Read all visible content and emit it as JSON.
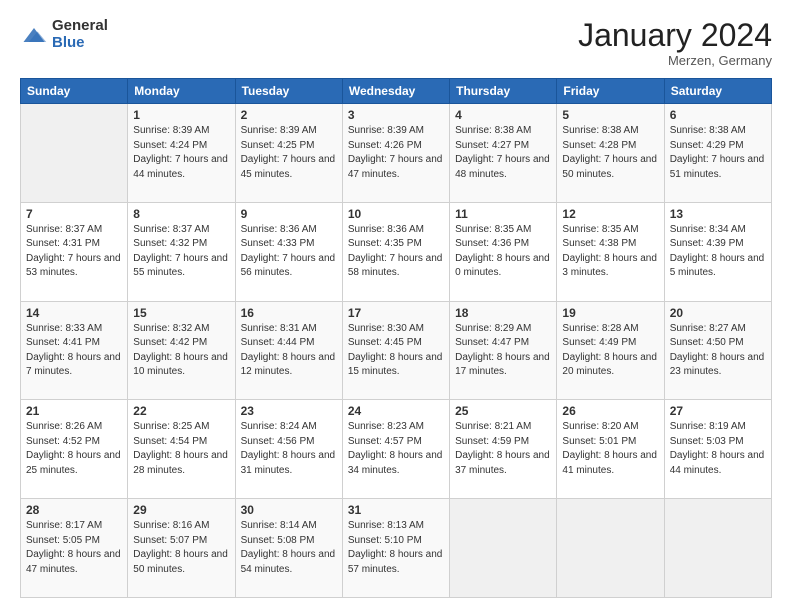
{
  "logo": {
    "general": "General",
    "blue": "Blue"
  },
  "header": {
    "month": "January 2024",
    "location": "Merzen, Germany"
  },
  "days_of_week": [
    "Sunday",
    "Monday",
    "Tuesday",
    "Wednesday",
    "Thursday",
    "Friday",
    "Saturday"
  ],
  "weeks": [
    [
      {
        "day": "",
        "sunrise": "",
        "sunset": "",
        "daylight": ""
      },
      {
        "day": "1",
        "sunrise": "Sunrise: 8:39 AM",
        "sunset": "Sunset: 4:24 PM",
        "daylight": "Daylight: 7 hours and 44 minutes."
      },
      {
        "day": "2",
        "sunrise": "Sunrise: 8:39 AM",
        "sunset": "Sunset: 4:25 PM",
        "daylight": "Daylight: 7 hours and 45 minutes."
      },
      {
        "day": "3",
        "sunrise": "Sunrise: 8:39 AM",
        "sunset": "Sunset: 4:26 PM",
        "daylight": "Daylight: 7 hours and 47 minutes."
      },
      {
        "day": "4",
        "sunrise": "Sunrise: 8:38 AM",
        "sunset": "Sunset: 4:27 PM",
        "daylight": "Daylight: 7 hours and 48 minutes."
      },
      {
        "day": "5",
        "sunrise": "Sunrise: 8:38 AM",
        "sunset": "Sunset: 4:28 PM",
        "daylight": "Daylight: 7 hours and 50 minutes."
      },
      {
        "day": "6",
        "sunrise": "Sunrise: 8:38 AM",
        "sunset": "Sunset: 4:29 PM",
        "daylight": "Daylight: 7 hours and 51 minutes."
      }
    ],
    [
      {
        "day": "7",
        "sunrise": "Sunrise: 8:37 AM",
        "sunset": "Sunset: 4:31 PM",
        "daylight": "Daylight: 7 hours and 53 minutes."
      },
      {
        "day": "8",
        "sunrise": "Sunrise: 8:37 AM",
        "sunset": "Sunset: 4:32 PM",
        "daylight": "Daylight: 7 hours and 55 minutes."
      },
      {
        "day": "9",
        "sunrise": "Sunrise: 8:36 AM",
        "sunset": "Sunset: 4:33 PM",
        "daylight": "Daylight: 7 hours and 56 minutes."
      },
      {
        "day": "10",
        "sunrise": "Sunrise: 8:36 AM",
        "sunset": "Sunset: 4:35 PM",
        "daylight": "Daylight: 7 hours and 58 minutes."
      },
      {
        "day": "11",
        "sunrise": "Sunrise: 8:35 AM",
        "sunset": "Sunset: 4:36 PM",
        "daylight": "Daylight: 8 hours and 0 minutes."
      },
      {
        "day": "12",
        "sunrise": "Sunrise: 8:35 AM",
        "sunset": "Sunset: 4:38 PM",
        "daylight": "Daylight: 8 hours and 3 minutes."
      },
      {
        "day": "13",
        "sunrise": "Sunrise: 8:34 AM",
        "sunset": "Sunset: 4:39 PM",
        "daylight": "Daylight: 8 hours and 5 minutes."
      }
    ],
    [
      {
        "day": "14",
        "sunrise": "Sunrise: 8:33 AM",
        "sunset": "Sunset: 4:41 PM",
        "daylight": "Daylight: 8 hours and 7 minutes."
      },
      {
        "day": "15",
        "sunrise": "Sunrise: 8:32 AM",
        "sunset": "Sunset: 4:42 PM",
        "daylight": "Daylight: 8 hours and 10 minutes."
      },
      {
        "day": "16",
        "sunrise": "Sunrise: 8:31 AM",
        "sunset": "Sunset: 4:44 PM",
        "daylight": "Daylight: 8 hours and 12 minutes."
      },
      {
        "day": "17",
        "sunrise": "Sunrise: 8:30 AM",
        "sunset": "Sunset: 4:45 PM",
        "daylight": "Daylight: 8 hours and 15 minutes."
      },
      {
        "day": "18",
        "sunrise": "Sunrise: 8:29 AM",
        "sunset": "Sunset: 4:47 PM",
        "daylight": "Daylight: 8 hours and 17 minutes."
      },
      {
        "day": "19",
        "sunrise": "Sunrise: 8:28 AM",
        "sunset": "Sunset: 4:49 PM",
        "daylight": "Daylight: 8 hours and 20 minutes."
      },
      {
        "day": "20",
        "sunrise": "Sunrise: 8:27 AM",
        "sunset": "Sunset: 4:50 PM",
        "daylight": "Daylight: 8 hours and 23 minutes."
      }
    ],
    [
      {
        "day": "21",
        "sunrise": "Sunrise: 8:26 AM",
        "sunset": "Sunset: 4:52 PM",
        "daylight": "Daylight: 8 hours and 25 minutes."
      },
      {
        "day": "22",
        "sunrise": "Sunrise: 8:25 AM",
        "sunset": "Sunset: 4:54 PM",
        "daylight": "Daylight: 8 hours and 28 minutes."
      },
      {
        "day": "23",
        "sunrise": "Sunrise: 8:24 AM",
        "sunset": "Sunset: 4:56 PM",
        "daylight": "Daylight: 8 hours and 31 minutes."
      },
      {
        "day": "24",
        "sunrise": "Sunrise: 8:23 AM",
        "sunset": "Sunset: 4:57 PM",
        "daylight": "Daylight: 8 hours and 34 minutes."
      },
      {
        "day": "25",
        "sunrise": "Sunrise: 8:21 AM",
        "sunset": "Sunset: 4:59 PM",
        "daylight": "Daylight: 8 hours and 37 minutes."
      },
      {
        "day": "26",
        "sunrise": "Sunrise: 8:20 AM",
        "sunset": "Sunset: 5:01 PM",
        "daylight": "Daylight: 8 hours and 41 minutes."
      },
      {
        "day": "27",
        "sunrise": "Sunrise: 8:19 AM",
        "sunset": "Sunset: 5:03 PM",
        "daylight": "Daylight: 8 hours and 44 minutes."
      }
    ],
    [
      {
        "day": "28",
        "sunrise": "Sunrise: 8:17 AM",
        "sunset": "Sunset: 5:05 PM",
        "daylight": "Daylight: 8 hours and 47 minutes."
      },
      {
        "day": "29",
        "sunrise": "Sunrise: 8:16 AM",
        "sunset": "Sunset: 5:07 PM",
        "daylight": "Daylight: 8 hours and 50 minutes."
      },
      {
        "day": "30",
        "sunrise": "Sunrise: 8:14 AM",
        "sunset": "Sunset: 5:08 PM",
        "daylight": "Daylight: 8 hours and 54 minutes."
      },
      {
        "day": "31",
        "sunrise": "Sunrise: 8:13 AM",
        "sunset": "Sunset: 5:10 PM",
        "daylight": "Daylight: 8 hours and 57 minutes."
      },
      {
        "day": "",
        "sunrise": "",
        "sunset": "",
        "daylight": ""
      },
      {
        "day": "",
        "sunrise": "",
        "sunset": "",
        "daylight": ""
      },
      {
        "day": "",
        "sunrise": "",
        "sunset": "",
        "daylight": ""
      }
    ]
  ]
}
